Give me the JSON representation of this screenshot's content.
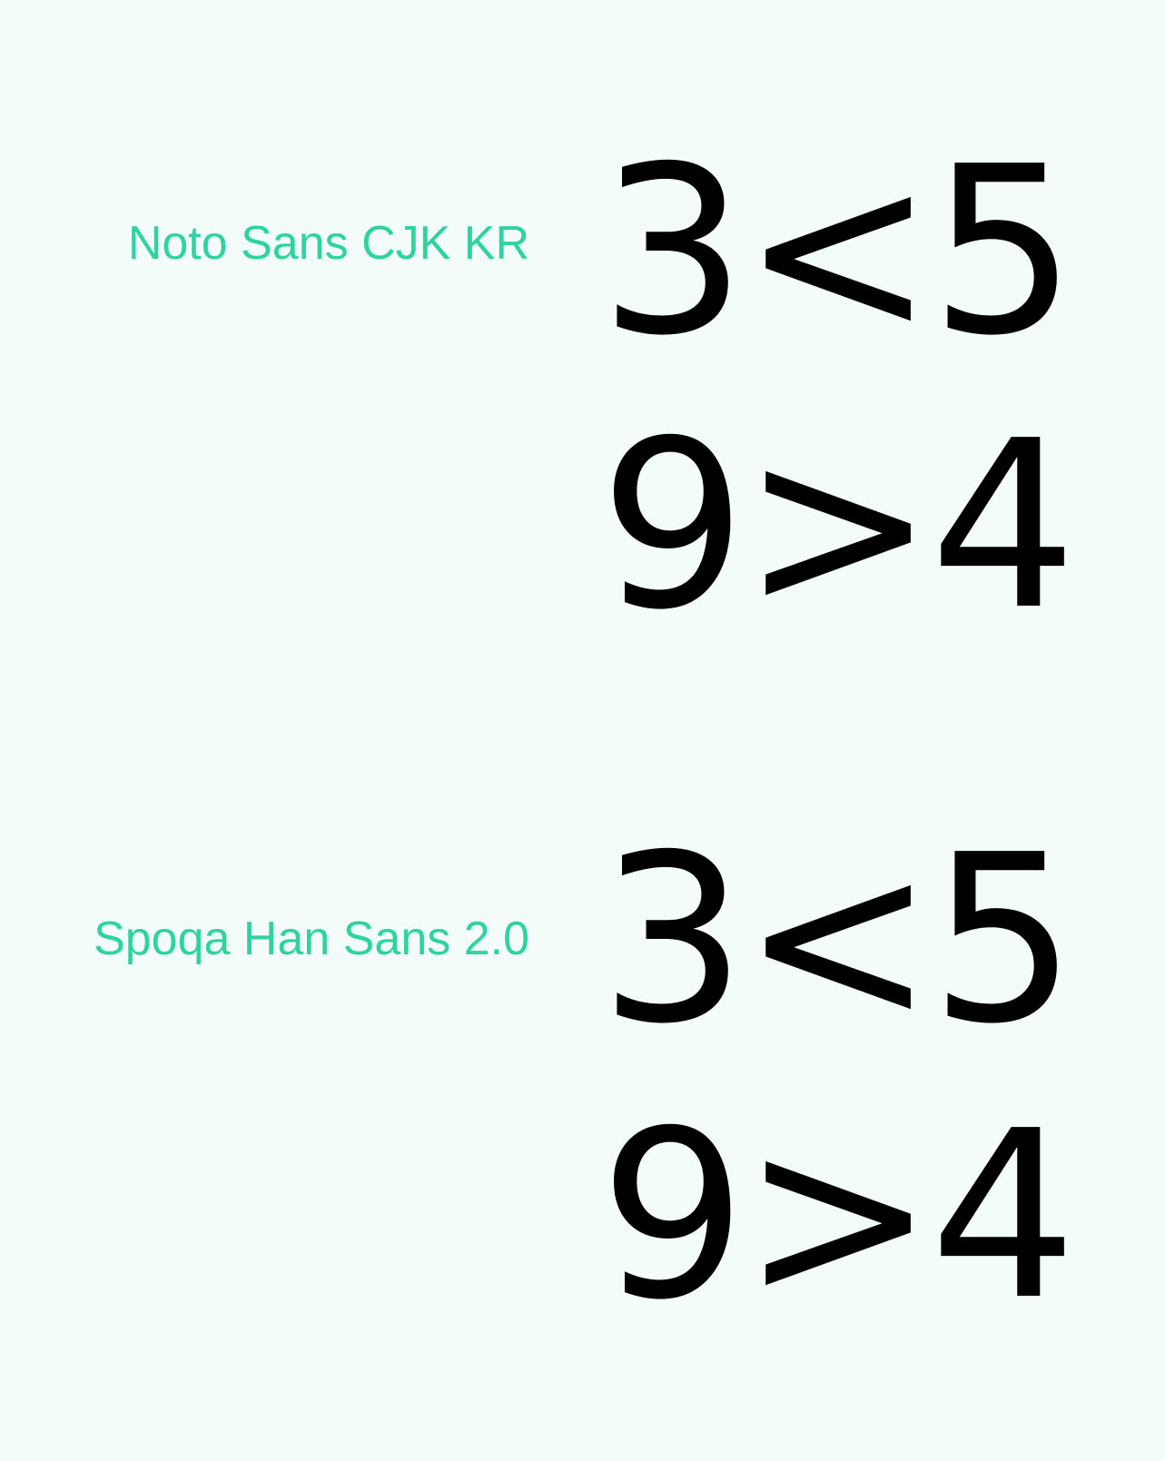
{
  "fonts": [
    {
      "label": "Noto Sans CJK KR",
      "line1": "3<5",
      "line2": "9>4"
    },
    {
      "label": "Spoqa Han Sans 2.0",
      "line1": "3<5",
      "line2": "9>4"
    }
  ],
  "colors": {
    "background": "#f3fcf9",
    "label": "#2fd3a0",
    "sample": "#000000"
  }
}
